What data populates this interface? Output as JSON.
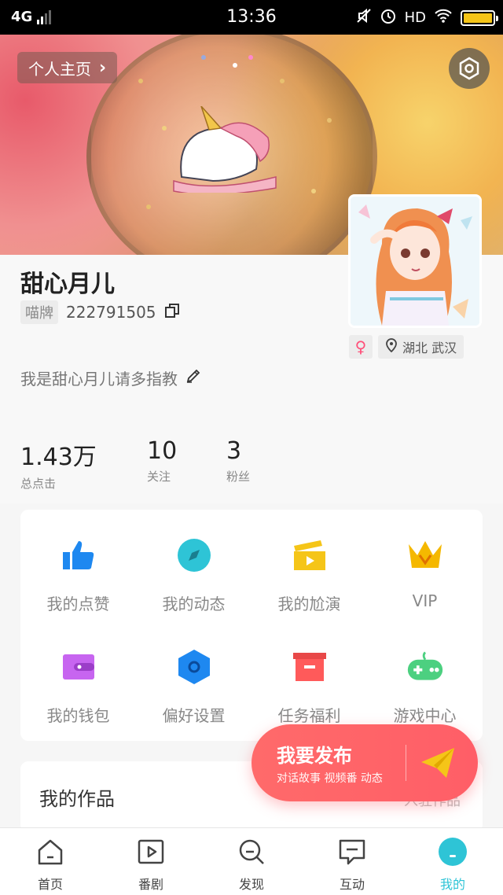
{
  "status_bar": {
    "network": "4G",
    "time": "13:36",
    "hd": "HD"
  },
  "cover": {
    "homepage_label": "个人主页"
  },
  "profile": {
    "nickname": "甜心月儿",
    "id_tag": "喵牌",
    "id_number": "222791505",
    "gender_symbol": "♀",
    "location": "湖北 武汉",
    "bio": "我是甜心月儿请多指教"
  },
  "stats": [
    {
      "value": "1.43万",
      "label": "总点击"
    },
    {
      "value": "10",
      "label": "关注"
    },
    {
      "value": "3",
      "label": "粉丝"
    }
  ],
  "menu": [
    {
      "label": "我的点赞",
      "icon": "thumbs-up-icon",
      "color": "#1e88f0"
    },
    {
      "label": "我的动态",
      "icon": "compass-icon",
      "color": "#2ec4d6"
    },
    {
      "label": "我的尬演",
      "icon": "clapperboard-icon",
      "color": "#f5c518"
    },
    {
      "label": "VIP",
      "icon": "crown-icon",
      "color": "#f5b800"
    },
    {
      "label": "我的钱包",
      "icon": "wallet-icon",
      "color": "#c765f0"
    },
    {
      "label": "偏好设置",
      "icon": "hexagon-settings-icon",
      "color": "#1e88f0"
    },
    {
      "label": "任务福利",
      "icon": "gift-box-icon",
      "color": "#ff5a5a"
    },
    {
      "label": "游戏中心",
      "icon": "gamepad-icon",
      "color": "#4cd080"
    }
  ],
  "works": {
    "title": "我的作品",
    "more": "入驻作品"
  },
  "publish": {
    "title": "我要发布",
    "subtitle": "对话故事 视频番 动态"
  },
  "tabs": [
    {
      "label": "首页",
      "icon": "home-icon"
    },
    {
      "label": "番剧",
      "icon": "play-icon"
    },
    {
      "label": "发现",
      "icon": "search-icon"
    },
    {
      "label": "互动",
      "icon": "chat-icon"
    },
    {
      "label": "我的",
      "icon": "profile-icon",
      "active": true
    }
  ],
  "colors": {
    "accent": "#2ec4d6",
    "publish": "#ff5e67",
    "battery": "#f5c518"
  }
}
